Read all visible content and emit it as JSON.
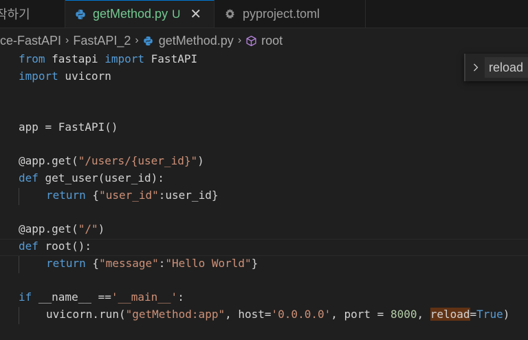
{
  "tabs": [
    {
      "label": "작하기"
    },
    {
      "label": "getMethod.py",
      "status": "U",
      "close": "✕"
    },
    {
      "label": "pyproject.toml"
    }
  ],
  "breadcrumb": {
    "items": [
      "ice-FastAPI",
      "FastAPI_2",
      "getMethod.py",
      "root"
    ],
    "separator": "›"
  },
  "find": {
    "value": "reload"
  },
  "code": {
    "l1": {
      "a": "from",
      "b": " fastapi ",
      "c": "import",
      "d": " FastAPI"
    },
    "l2": {
      "a": "import",
      "b": " uvicorn"
    },
    "l5": {
      "a": "app = FastAPI()"
    },
    "l7": {
      "a": "@app.get(",
      "b": "\"/users/{user_id}\"",
      "c": ")"
    },
    "l8": {
      "a": "def",
      "b": " get_user(user_id):"
    },
    "l9": {
      "a": "return",
      "b": " {",
      "c": "\"user_id\"",
      "d": ":user_id}"
    },
    "l11": {
      "a": "@app.get(",
      "b": "\"/\"",
      "c": ")"
    },
    "l12": {
      "a": "def",
      "b": " root():"
    },
    "l13": {
      "a": "return",
      "b": " {",
      "c": "\"message\"",
      "d": ":",
      "e": "\"Hello World\"",
      "f": "}"
    },
    "l15": {
      "a": "if",
      "b": " __name__ ==",
      "c": "'__main__'",
      "d": ":"
    },
    "l16": {
      "a": "uvicorn.run(",
      "b": "\"getMethod:app\"",
      "c": ", host=",
      "d": "'0.0.0.0'",
      "e": ", port = ",
      "f": "8000",
      "g": ", ",
      "h": "reload",
      "i": "=",
      "j": "True",
      "k": ")"
    }
  },
  "colors": {
    "python_blue": "#3572a5",
    "python_yellow": "#ffd43b",
    "accent": "#0078d4",
    "untracked": "#73c991",
    "match_highlight": "#613214"
  },
  "icons": [
    "python-icon",
    "close-icon",
    "gear-icon",
    "cube-icon",
    "chevron-right-icon"
  ]
}
